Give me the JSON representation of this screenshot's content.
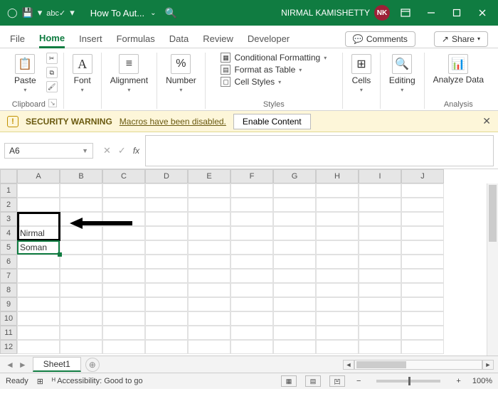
{
  "titlebar": {
    "doc_name": "How To Aut...",
    "user_name": "NIRMAL KAMISHETTY",
    "user_initials": "NK"
  },
  "tabs": {
    "file": "File",
    "home": "Home",
    "insert": "Insert",
    "formulas": "Formulas",
    "data": "Data",
    "review": "Review",
    "developer": "Developer",
    "comments": "Comments",
    "share": "Share"
  },
  "ribbon": {
    "clipboard": {
      "paste": "Paste",
      "label": "Clipboard"
    },
    "font": {
      "btn": "Font"
    },
    "alignment": {
      "btn": "Alignment"
    },
    "number": {
      "btn": "Number"
    },
    "styles": {
      "cond": "Conditional Formatting",
      "table": "Format as Table",
      "cell": "Cell Styles",
      "label": "Styles"
    },
    "cells": {
      "btn": "Cells"
    },
    "editing": {
      "btn": "Editing"
    },
    "analysis": {
      "btn": "Analyze Data",
      "label": "Analysis"
    }
  },
  "msgbar": {
    "title": "SECURITY WARNING",
    "text": "Macros have been disabled.",
    "button": "Enable Content"
  },
  "namebox": "A6",
  "fx_label": "fx",
  "columns": [
    "A",
    "B",
    "C",
    "D",
    "E",
    "F",
    "G",
    "H",
    "I",
    "J"
  ],
  "rows": [
    "1",
    "2",
    "3",
    "4",
    "5",
    "6",
    "7",
    "8",
    "9",
    "10",
    "11",
    "12"
  ],
  "cells": {
    "a4": "Nirmal",
    "a5": "Soman"
  },
  "sheettabs": {
    "sheet1": "Sheet1",
    "add": "+"
  },
  "statusbar": {
    "ready": "Ready",
    "acc": "Accessibility: Good to go",
    "zoom": "100%",
    "minus": "−",
    "plus": "+"
  }
}
